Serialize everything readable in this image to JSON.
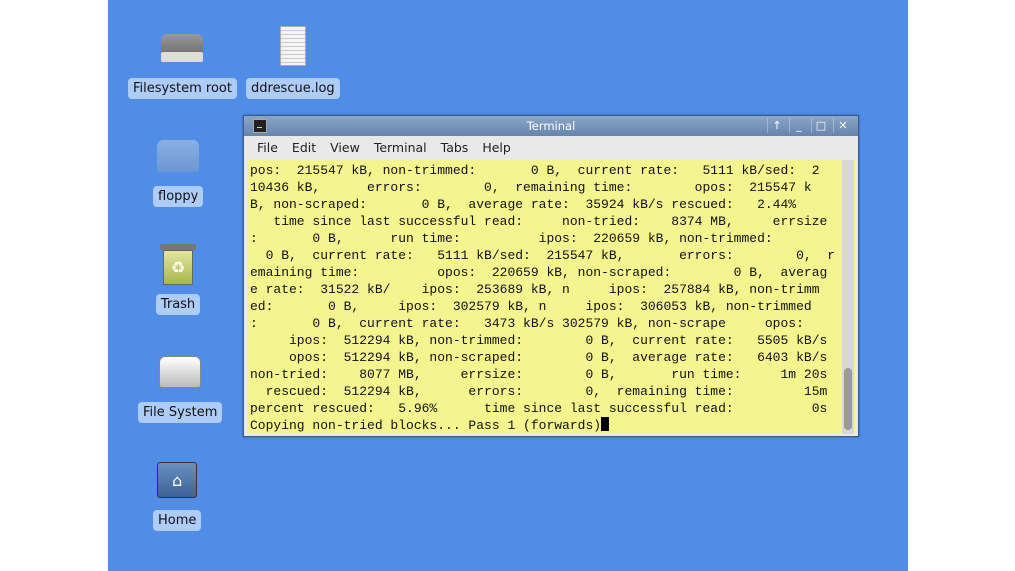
{
  "desktop": {
    "icons": [
      {
        "label": "Filesystem root",
        "icon": "harddrive-icon"
      },
      {
        "label": "ddrescue.log",
        "icon": "text-file-icon"
      },
      {
        "label": "floppy",
        "icon": "floppy-drive-icon"
      },
      {
        "label": "Trash",
        "icon": "trash-icon"
      },
      {
        "label": "File System",
        "icon": "harddrive-icon"
      },
      {
        "label": "Home",
        "icon": "home-folder-icon"
      }
    ],
    "background": "#4f8de6"
  },
  "terminal": {
    "title": "Terminal",
    "buttons": [
      "↑",
      "_",
      "□",
      "✕"
    ],
    "menu": [
      "File",
      "Edit",
      "View",
      "Terminal",
      "Tabs",
      "Help"
    ],
    "lines": [
      "pos:  215547 kB, non-trimmed:       0 B,  current rate:   5111 kB/sed:  2",
      "10436 kB,      errors:        0,  remaining time:        opos:  215547 k",
      "B, non-scraped:       0 B,  average rate:  35924 kB/s rescued:   2.44%",
      "   time since last successful read:     non-tried:    8374 MB,     errsize",
      ":       0 B,      run time:          ipos:  220659 kB, non-trimmed:",
      "  0 B,  current rate:   5111 kB/sed:  215547 kB,       errors:        0,  r",
      "emaining time:          opos:  220659 kB, non-scraped:        0 B,  averag",
      "e rate:  31522 kB/    ipos:  253689 kB, n     ipos:  257884 kB, non-trimm",
      "ed:       0 B,     ipos:  302579 kB, n     ipos:  306053 kB, non-trimmed",
      ":       0 B,  current rate:   3473 kB/s 302579 kB, non-scrape     opos:",
      "     ipos:  512294 kB, non-trimmed:        0 B,  current rate:   5505 kB/s",
      "     opos:  512294 kB, non-scraped:        0 B,  average rate:   6403 kB/s",
      "non-tried:    8077 MB,     errsize:        0 B,       run time:     1m 20s",
      "  rescued:  512294 kB,      errors:        0,  remaining time:         15m",
      "percent rescued:   5.96%      time since last successful read:          0s",
      "Copying non-tried blocks... Pass 1 (forwards)"
    ]
  }
}
